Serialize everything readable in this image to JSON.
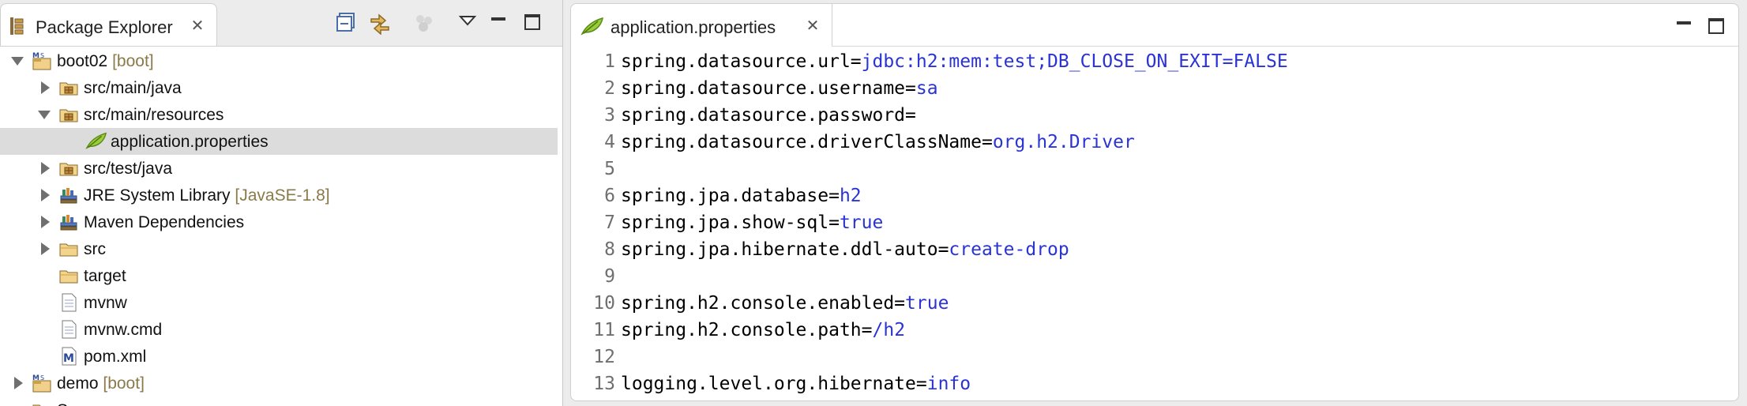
{
  "package_explorer": {
    "title": "Package Explorer",
    "tree": [
      {
        "label": "boot02",
        "decoration": "[boot]",
        "icon": "maven-project-icon",
        "twisty": "expanded",
        "depth": 0
      },
      {
        "label": "src/main/java",
        "decoration": "",
        "icon": "source-folder-icon",
        "twisty": "collapsed",
        "depth": 1
      },
      {
        "label": "src/main/resources",
        "decoration": "",
        "icon": "source-folder-icon",
        "twisty": "expanded",
        "depth": 1
      },
      {
        "label": "application.properties",
        "decoration": "",
        "icon": "properties-file-icon",
        "twisty": "none",
        "depth": 2,
        "selected": true
      },
      {
        "label": "src/test/java",
        "decoration": "",
        "icon": "source-folder-icon",
        "twisty": "collapsed",
        "depth": 1
      },
      {
        "label": "JRE System Library",
        "decoration": "[JavaSE-1.8]",
        "icon": "library-icon",
        "twisty": "collapsed",
        "depth": 1
      },
      {
        "label": "Maven Dependencies",
        "decoration": "",
        "icon": "library-icon",
        "twisty": "collapsed",
        "depth": 1
      },
      {
        "label": "src",
        "decoration": "",
        "icon": "folder-icon",
        "twisty": "collapsed",
        "depth": 1
      },
      {
        "label": "target",
        "decoration": "",
        "icon": "folder-icon",
        "twisty": "none",
        "depth": 1
      },
      {
        "label": "mvnw",
        "decoration": "",
        "icon": "file-icon",
        "twisty": "none",
        "depth": 1
      },
      {
        "label": "mvnw.cmd",
        "decoration": "",
        "icon": "file-icon",
        "twisty": "none",
        "depth": 1
      },
      {
        "label": "pom.xml",
        "decoration": "",
        "icon": "maven-pom-icon",
        "twisty": "none",
        "depth": 1
      },
      {
        "label": "demo",
        "decoration": "[boot]",
        "icon": "maven-project-icon",
        "twisty": "collapsed",
        "depth": 0
      },
      {
        "label": "Servers",
        "decoration": "",
        "icon": "folder-icon",
        "twisty": "none",
        "depth": 0
      }
    ]
  },
  "editor": {
    "tab_title": "application.properties",
    "lines": [
      {
        "num": "1",
        "key": "spring.datasource.url=",
        "value": "jdbc:h2:mem:test;DB_CLOSE_ON_EXIT=FALSE"
      },
      {
        "num": "2",
        "key": "spring.datasource.username=",
        "value": "sa"
      },
      {
        "num": "3",
        "key": "spring.datasource.password=",
        "value": ""
      },
      {
        "num": "4",
        "key": "spring.datasource.driverClassName=",
        "value": "org.h2.Driver"
      },
      {
        "num": "5",
        "key": "",
        "value": ""
      },
      {
        "num": "6",
        "key": "spring.jpa.database=",
        "value": "h2"
      },
      {
        "num": "7",
        "key": "spring.jpa.show-sql=",
        "value": "true"
      },
      {
        "num": "8",
        "key": "spring.jpa.hibernate.ddl-auto=",
        "value": "create-drop"
      },
      {
        "num": "9",
        "key": "",
        "value": ""
      },
      {
        "num": "10",
        "key": "spring.h2.console.enabled=",
        "value": "true"
      },
      {
        "num": "11",
        "key": "spring.h2.console.path=",
        "value": "/h2"
      },
      {
        "num": "12",
        "key": "",
        "value": ""
      },
      {
        "num": "13",
        "key": "logging.level.org.hibernate=",
        "value": "info"
      }
    ]
  },
  "colors": {
    "value_blue": "#2a33d4",
    "line_number_gray": "#6f6f6f",
    "selection_gray": "#dcdcdc",
    "decoration_brown": "#8a7a4a"
  }
}
